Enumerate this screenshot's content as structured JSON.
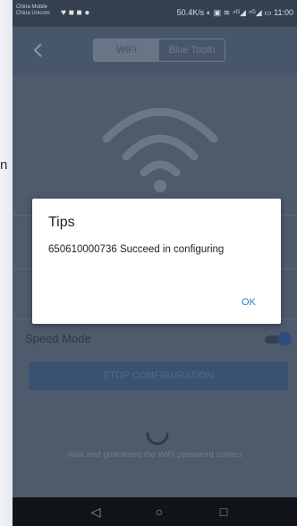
{
  "background": {
    "left_text": "n"
  },
  "status_bar": {
    "carrier_line1": "China Mobile",
    "carrier_line2": "China Unicom",
    "left_icons": "♥ ■ ■ ●",
    "right_text": "50.4K/s ◐ ▣ ≋ ⁴ᴳ◢ ⁴ᴳ◢ ▭ 11:00"
  },
  "header": {
    "back_icon": "back-arrow-icon",
    "tabs": [
      {
        "label": "WiFi",
        "active": true
      },
      {
        "label": "Blue Tooth",
        "active": false
      }
    ]
  },
  "form": {
    "speed_mode_label": "Speed Mode",
    "speed_mode_on": true,
    "stop_button_label": "STOP CONFIGURATION",
    "hint": "Wait and guarantee the WiFi password correct"
  },
  "dialog": {
    "title": "Tips",
    "message": "650610000736 Succeed in configuring",
    "ok_label": "OK"
  },
  "nav_bar": {
    "back": "◁",
    "home": "○",
    "recents": "□"
  },
  "colors": {
    "dialog_button": "#2d7dd2",
    "screen_dim": "#4d5b6d",
    "toggle_on": "#2d4f7a"
  }
}
